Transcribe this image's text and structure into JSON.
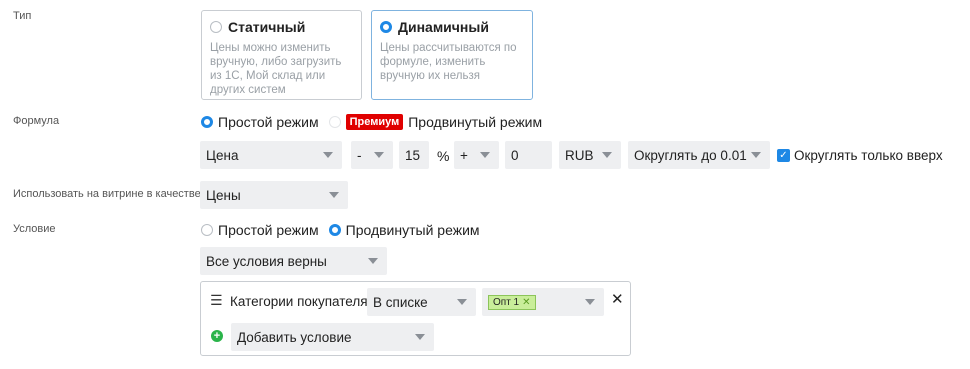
{
  "labels": {
    "type": "Тип",
    "formula": "Формула",
    "use_as": "Использовать на витрине в качестве",
    "condition": "Условие"
  },
  "type_cards": [
    {
      "title": "Статичный",
      "description": "Цены можно изменить вручную, либо загрузить из 1С, Мой склад или других систем",
      "selected": false
    },
    {
      "title": "Динамичный",
      "description": "Цены рассчитываются по формуле, изменить вручную их нельзя",
      "selected": true
    }
  ],
  "formula": {
    "mode_simple": "Простой режим",
    "premium_badge": "Премиум",
    "mode_advanced": "Продвинутый режим",
    "base": "Цена",
    "operator1": "-",
    "amount": "15",
    "percent_sign": "%",
    "operator2": "+",
    "offset": "0",
    "currency": "RUB",
    "rounding": "Округлять до 0.01",
    "round_up_label": "Округлять только вверх",
    "round_up_checked": true
  },
  "use_as_value": "Цены",
  "condition": {
    "mode_simple": "Простой режим",
    "mode_advanced": "Продвинутый режим",
    "combinator": "Все условия верны",
    "rule": {
      "field": "Категории покупателя",
      "operator": "В списке",
      "tags": [
        "Опт 1"
      ]
    },
    "add_label": "Добавить условие"
  },
  "icons": {
    "drag": "drag-handle-icon",
    "remove": "close-icon",
    "add": "plus-circle-icon",
    "dropdown": "chevron-down-icon"
  },
  "colors": {
    "accent": "#1e88e5",
    "premium": "#e00000",
    "tag_bg": "#c9ee9a",
    "add_icon": "#2ab44a"
  }
}
